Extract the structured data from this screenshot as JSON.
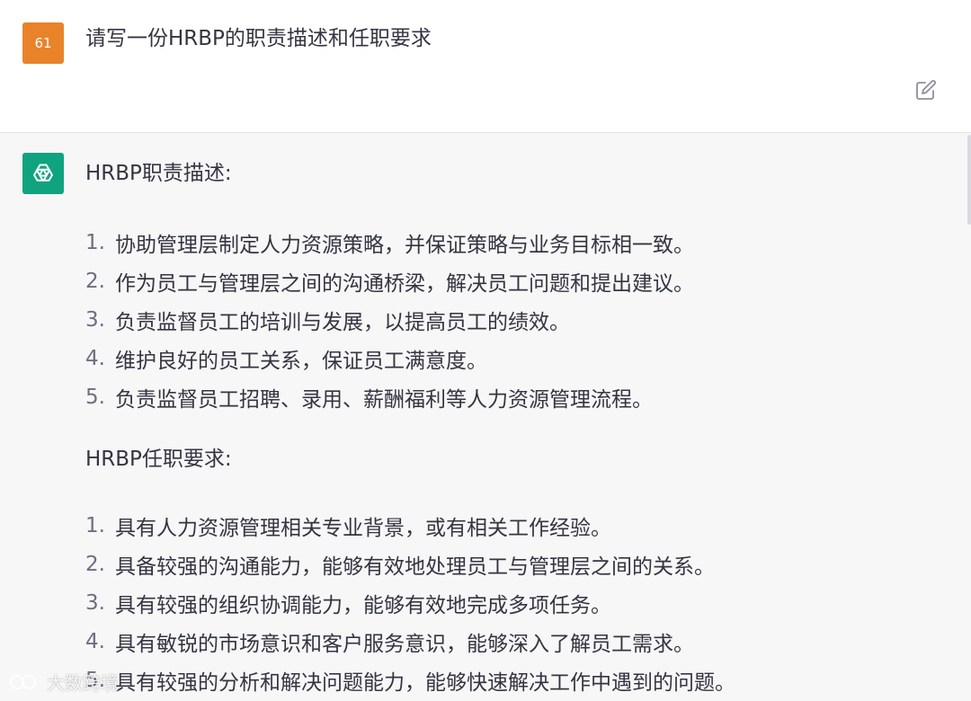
{
  "user_message": {
    "avatar_label": "61",
    "text": "请写一份HRBP的职责描述和任职要求"
  },
  "assistant_message": {
    "section1": {
      "heading": "HRBP职责描述:",
      "items": [
        {
          "num": "1.",
          "text": "协助管理层制定人力资源策略，并保证策略与业务目标相一致。"
        },
        {
          "num": "2.",
          "text": "作为员工与管理层之间的沟通桥梁，解决员工问题和提出建议。"
        },
        {
          "num": "3.",
          "text": "负责监督员工的培训与发展，以提高员工的绩效。"
        },
        {
          "num": "4.",
          "text": "维护良好的员工关系，保证员工满意度。"
        },
        {
          "num": "5.",
          "text": "负责监督员工招聘、录用、薪酬福利等人力资源管理流程。"
        }
      ]
    },
    "section2": {
      "heading": "HRBP任职要求:",
      "items": [
        {
          "num": "1.",
          "text": "具有人力资源管理相关专业背景，或有相关工作经验。"
        },
        {
          "num": "2.",
          "text": "具备较强的沟通能力，能够有效地处理员工与管理层之间的关系。"
        },
        {
          "num": "3.",
          "text": "具有较强的组织协调能力，能够有效地完成多项任务。"
        },
        {
          "num": "4.",
          "text": "具有敏锐的市场意识和客户服务意识，能够深入了解员工需求。"
        },
        {
          "num": "5.",
          "text": "具有较强的分析和解决问题能力，能够快速解决工作中遇到的问题。"
        }
      ]
    }
  },
  "watermark": {
    "text": "大数跨境"
  },
  "icons": {
    "edit": "edit-icon",
    "bot": "openai-logo-icon"
  },
  "colors": {
    "user_avatar": "#e8832a",
    "bot_avatar": "#10a37f",
    "assistant_bg": "#f7f7f8"
  }
}
